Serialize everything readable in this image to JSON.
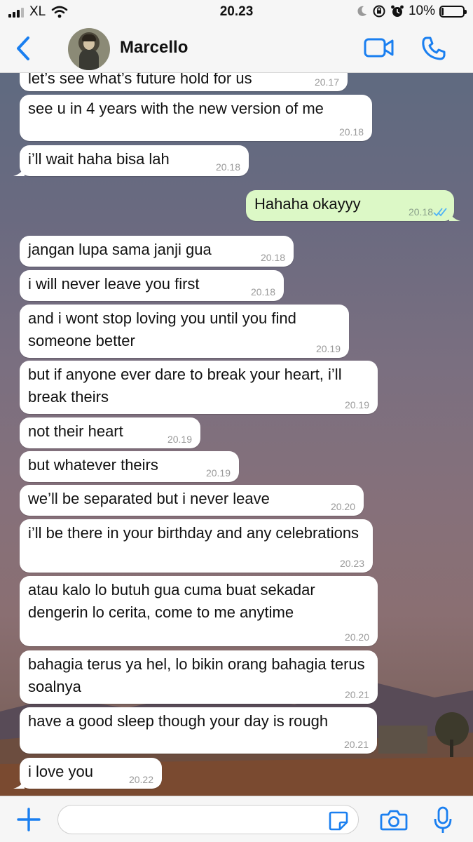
{
  "status_bar": {
    "carrier": "XL",
    "time": "20.23",
    "battery_text": "10%",
    "battery_level": 0.1
  },
  "header": {
    "contact_name": "Marcello"
  },
  "messages": [
    {
      "text": "let’s see what’s future hold for us",
      "time": "20.17",
      "direction": "in"
    },
    {
      "text": "see u in 4 years with the new version of me",
      "time": "20.18",
      "direction": "in"
    },
    {
      "text": "i’ll wait haha bisa lah",
      "time": "20.18",
      "direction": "in"
    },
    {
      "text": "Hahaha okayyy",
      "time": "20.18",
      "direction": "out"
    },
    {
      "text": "jangan lupa sama janji gua",
      "time": "20.18",
      "direction": "in"
    },
    {
      "text": "i will never leave you first",
      "time": "20.18",
      "direction": "in"
    },
    {
      "text": "and i wont stop loving you until you find someone better",
      "time": "20.19",
      "direction": "in"
    },
    {
      "text": "but if anyone ever dare to break your heart, i’ll break theirs",
      "time": "20.19",
      "direction": "in"
    },
    {
      "text": "not their heart",
      "time": "20.19",
      "direction": "in"
    },
    {
      "text": "but whatever theirs",
      "time": "20.19",
      "direction": "in"
    },
    {
      "text": "we’ll be separated but i never leave",
      "time": "20.20",
      "direction": "in"
    },
    {
      "text": "i’ll be there in your birthday and any celebrations",
      "time": "20.23",
      "direction": "in"
    },
    {
      "text": "atau kalo lo butuh gua cuma buat sekadar dengerin lo cerita, come to me anytime",
      "time": "20.20",
      "direction": "in"
    },
    {
      "text": "bahagia terus ya hel, lo bikin orang bahagia terus soalnya",
      "time": "20.21",
      "direction": "in"
    },
    {
      "text": "have a good sleep though your day is rough",
      "time": "20.21",
      "direction": "in"
    },
    {
      "text": "i love you",
      "time": "20.22",
      "direction": "in"
    }
  ],
  "input": {
    "value": ""
  },
  "colors": {
    "accent": "#1a7ff0",
    "incoming_bubble": "#ffffff",
    "outgoing_bubble": "#dcf8c6",
    "read_ticks": "#4fb3f6"
  },
  "icons": [
    "signal-icon",
    "wifi-icon",
    "moon-icon",
    "orientation-lock-icon",
    "alarm-icon",
    "battery-icon",
    "back-chevron-icon",
    "video-call-icon",
    "phone-icon",
    "plus-icon",
    "sticker-icon",
    "camera-icon",
    "microphone-icon",
    "double-check-icon"
  ]
}
